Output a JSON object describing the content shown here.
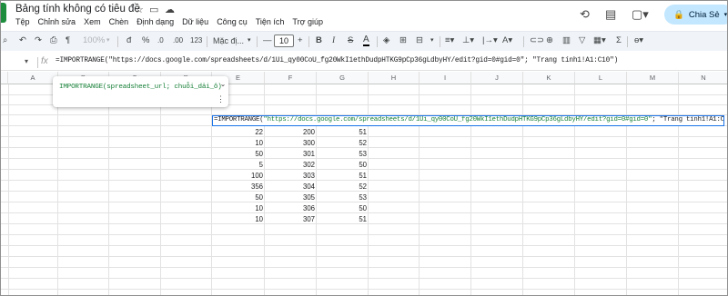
{
  "window": {
    "doc_title": "Bảng tính không có tiêu đề",
    "menu": [
      "Tệp",
      "Chỉnh sửa",
      "Xem",
      "Chèn",
      "Định dạng",
      "Dữ liệu",
      "Công cụ",
      "Tiện ích",
      "Trợ giúp"
    ],
    "share_label": "Chia Sẻ"
  },
  "toolbar": {
    "zoom": "100%",
    "currency": "đ",
    "percent": "%",
    "dec_decrease": ".0",
    "dec_increase": ".00",
    "number_format": "123",
    "font_name": "Mặc đị...",
    "font_size": "10",
    "bold": "B",
    "italic": "I",
    "strike": "S",
    "text_color": "A",
    "sum_icon": "Σ"
  },
  "formula_bar": {
    "fx_label": "fx",
    "formula": "=IMPORTRANGE(\"https://docs.google.com/spreadsheets/d/1Ui_qy00CoU_fg20WkI1ethDudpHTKG9pCp36gLdbyHY/edit?gid=0#gid=0\"; \"Trang tính1!A1:C10\")"
  },
  "columns": [
    "A",
    "B",
    "C",
    "D",
    "E",
    "F",
    "G",
    "H",
    "I",
    "J",
    "K",
    "L",
    "M",
    "N"
  ],
  "tooltip": {
    "signature": "IMPORTRANGE(spreadsheet_url; chuỗi_dải_ô)"
  },
  "active_cell": {
    "prefix": "=IMPORTRANGE(",
    "url": "\"https://docs.google.com/spreadsheets/d/1Ui_qy00CoU_fg20WkI1ethDudpHTKG9pCp36gLdbyHY/edit?gid=0#gid=0\"",
    "suffix": "; \"Trang tính1!A1:C10\")"
  },
  "table": {
    "rows": [
      [
        "22",
        "200",
        "51"
      ],
      [
        "10",
        "300",
        "52"
      ],
      [
        "50",
        "301",
        "53"
      ],
      [
        "5",
        "302",
        "50"
      ],
      [
        "100",
        "303",
        "51"
      ],
      [
        "356",
        "304",
        "52"
      ],
      [
        "50",
        "305",
        "53"
      ],
      [
        "10",
        "306",
        "50"
      ],
      [
        "10",
        "307",
        "51"
      ]
    ]
  }
}
